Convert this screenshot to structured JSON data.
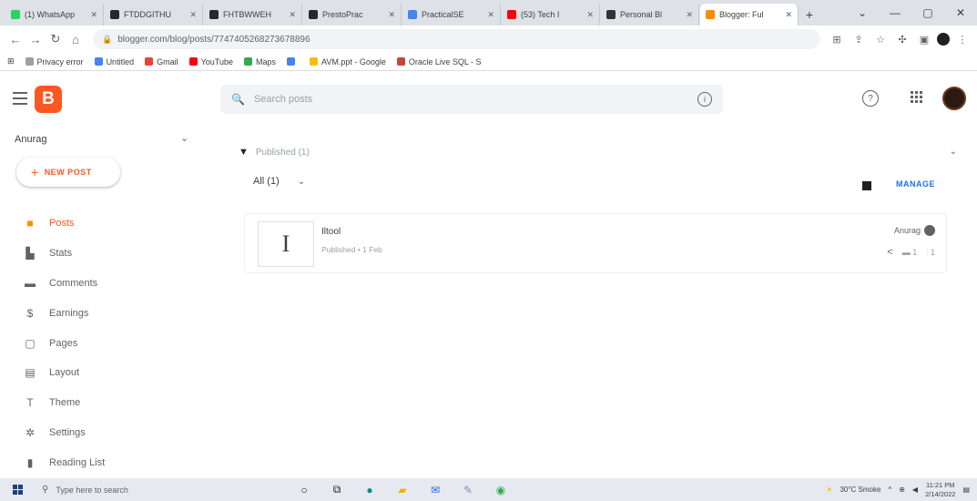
{
  "browser": {
    "tabs": [
      {
        "label": "(1) WhatsApp",
        "color": "#25d366"
      },
      {
        "label": "FTDDGITHU",
        "color": "#24292f"
      },
      {
        "label": "FHTBWWEH",
        "color": "#24292f"
      },
      {
        "label": "PrestoPrac",
        "color": "#24292f"
      },
      {
        "label": "PracticalSE",
        "color": "#4285f4"
      },
      {
        "label": "(53) Tech I",
        "color": "#ff0000"
      },
      {
        "label": "Personal Bl",
        "color": "#333333"
      },
      {
        "label": "Blogger: Ful",
        "color": "#ff8a00",
        "active": true
      }
    ],
    "new_tab": "+",
    "url": "blogger.com/blog/posts/7747405268273678896",
    "bookmarks": [
      {
        "label": "Privacy error",
        "color": "#9aa0a6"
      },
      {
        "label": "Untitled",
        "color": "#4285f4"
      },
      {
        "label": "Gmail",
        "color": "#ea4335"
      },
      {
        "label": "YouTube",
        "color": "#ff0000"
      },
      {
        "label": "Maps",
        "color": "#34a853"
      },
      {
        "label": "",
        "color": "#4285f4"
      },
      {
        "label": "AVM.ppt - Google",
        "color": "#fbbc04"
      },
      {
        "label": "Oracle Live SQL - S",
        "color": "#c74634"
      }
    ]
  },
  "header": {
    "logo_letter": "B",
    "search_placeholder": "Search posts"
  },
  "sidebar": {
    "blog_name": "Anurag",
    "new_post": "NEW POST",
    "items": [
      {
        "label": "Posts",
        "icon": "posts-icon",
        "glyph": "■",
        "active": true
      },
      {
        "label": "Stats",
        "icon": "stats-icon",
        "glyph": "▙"
      },
      {
        "label": "Comments",
        "icon": "comments-icon",
        "glyph": "▬"
      },
      {
        "label": "Earnings",
        "icon": "earnings-icon",
        "glyph": "$"
      },
      {
        "label": "Pages",
        "icon": "pages-icon",
        "glyph": "▢"
      },
      {
        "label": "Layout",
        "icon": "layout-icon",
        "glyph": "▤"
      },
      {
        "label": "Theme",
        "icon": "theme-icon",
        "glyph": "T"
      },
      {
        "label": "Settings",
        "icon": "settings-icon",
        "glyph": "✲"
      },
      {
        "label": "Reading List",
        "icon": "reading-list-icon",
        "glyph": "▮"
      }
    ]
  },
  "main": {
    "published_label": "Published (1)",
    "filter_label": "All (1)",
    "manage_label": "MANAGE",
    "posts": [
      {
        "thumb": "I",
        "title": "Iltool",
        "meta": "Published • 1 Feb",
        "author": "Anurag",
        "comments": "1",
        "views": "1"
      }
    ]
  },
  "taskbar": {
    "search_placeholder": "Type here to search",
    "weather": "30°C Smoke",
    "time": "11:21 PM",
    "date": "2/14/2022"
  },
  "colors": {
    "accent": "#ff5722",
    "link": "#1a73e8"
  }
}
